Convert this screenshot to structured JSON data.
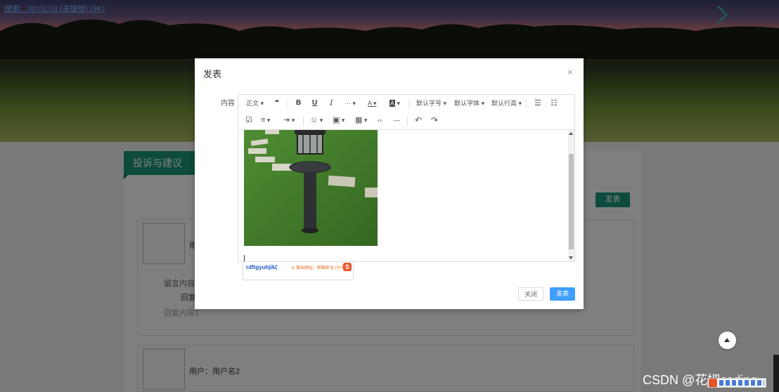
{
  "hero": {
    "search_caption": "搜索：00:01:03 (关键帧) (9K)"
  },
  "page": {
    "section_title": "投诉与建议",
    "post_button": "发表",
    "cards": [
      {
        "user": "用户",
        "message": "留言内容1",
        "reply_label": "回复",
        "reply_content": "回复内容1"
      },
      {
        "user": "用户：用户名2"
      }
    ]
  },
  "modal": {
    "title": "发表",
    "close_symbol": "×",
    "field_label": "内容",
    "toolbar": {
      "paragraph": "正文",
      "quote": "❝",
      "bold": "B",
      "underline": "U",
      "italic": "I",
      "more": "···",
      "font_color": "A",
      "bg_color": "A",
      "font_size": "默认字号",
      "font_family": "默认字体",
      "line_height": "默认行高",
      "bullet_list": "☰",
      "numbered_list": "☷",
      "todo": "☑",
      "align": "≡",
      "indent": "⇥",
      "emoji": "☺",
      "image": "▣",
      "table": "▦",
      "code": "‹›",
      "divider": "—",
      "undo": "↶",
      "redo": "↷"
    },
    "ime_popup": {
      "text": "rdftgyuhjik(",
      "hint": "① 搜出网址：邮箱补全 (分号)",
      "logo": "S"
    },
    "buttons": {
      "close": "关闭",
      "publish": "发表"
    }
  },
  "watermark": "CSDN @花椒coding"
}
